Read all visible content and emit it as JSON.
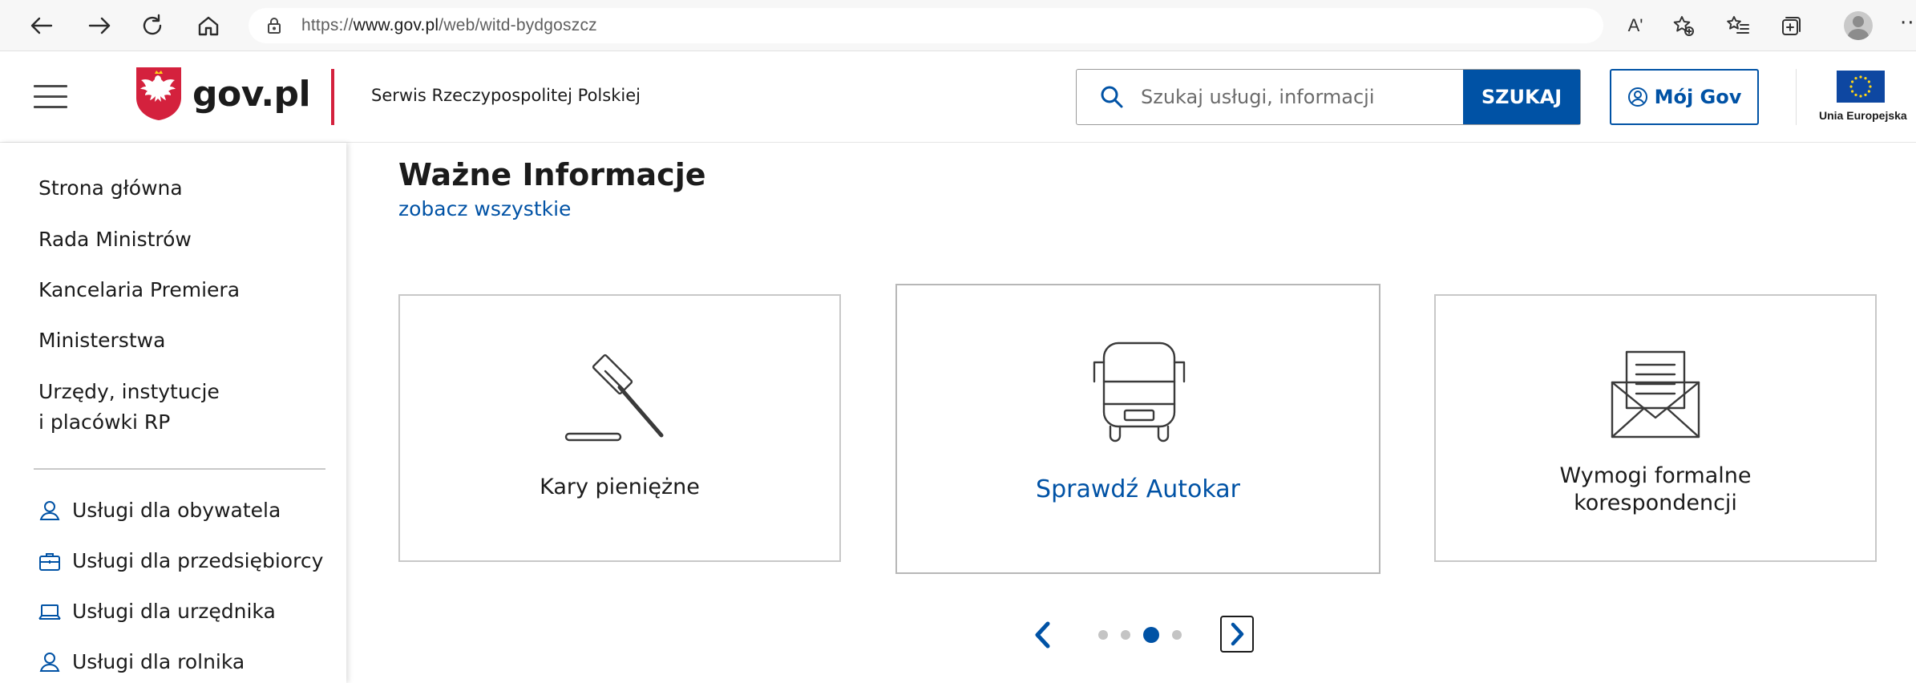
{
  "browser": {
    "url_prefix": "https://",
    "url_host": "www.gov.pl",
    "url_path": "/web/witd-bydgoszcz",
    "read_aloud_label": "Aʹ"
  },
  "header": {
    "logo_text": "gov.pl",
    "serwis": "Serwis Rzeczypospolitej Polskiej",
    "search_placeholder": "Szukaj usługi, informacji",
    "search_button": "SZUKAJ",
    "account_button": "Mój Gov",
    "eu_label": "Unia Europejska"
  },
  "sidebar": {
    "items": [
      {
        "label": "Strona główna"
      },
      {
        "label": "Rada Ministrów"
      },
      {
        "label": "Kancelaria Premiera"
      },
      {
        "label": "Ministerstwa"
      },
      {
        "label_line1": "Urzędy, instytucje",
        "label_line2": "i placówki RP"
      }
    ],
    "services": [
      {
        "label": "Usługi dla obywatela",
        "icon": "person-icon"
      },
      {
        "label": "Usługi dla przedsiębiorcy",
        "icon": "briefcase-icon"
      },
      {
        "label": "Usługi dla urzędnika",
        "icon": "laptop-icon"
      },
      {
        "label": "Usługi dla rolnika",
        "icon": "person-icon"
      }
    ]
  },
  "main": {
    "title": "Ważne Informacje",
    "see_all": "zobacz wszystkie",
    "cards": [
      {
        "label": "Kary pieniężne",
        "icon": "gavel-icon"
      },
      {
        "label": "Sprawdź Autokar",
        "icon": "bus-icon"
      },
      {
        "label_line1": "Wymogi formalne",
        "label_line2": "korespondencji",
        "icon": "envelope-letter-icon"
      }
    ],
    "carousel": {
      "total_slides": 4,
      "active_slide": 3
    }
  },
  "colors": {
    "brand_blue": "#0052a5",
    "brand_red": "#d4213d",
    "eu_blue": "#0e47a1",
    "eu_gold": "#ffd617"
  }
}
